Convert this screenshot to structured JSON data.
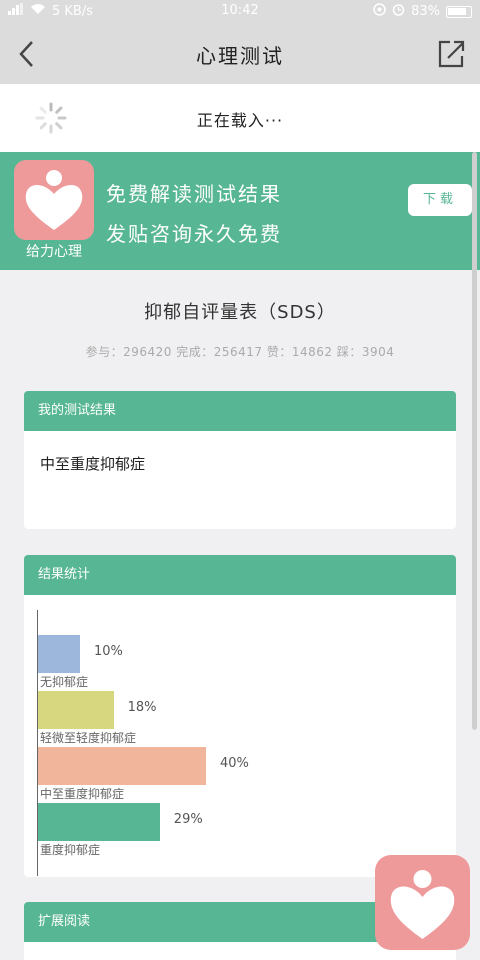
{
  "status_bar": {
    "network_speed": "5 KB/s",
    "time": "10:42",
    "battery": "83%"
  },
  "nav": {
    "title": "心理测试",
    "back_icon": "back-chevron-icon",
    "share_icon": "share-icon"
  },
  "loading": {
    "text": "正在载入···",
    "icon": "spinner-icon"
  },
  "banner": {
    "logo_text": "给力心理",
    "line1": "免费解读测试结果",
    "line2": "发贴咨询永久免费",
    "download_label": "下载",
    "logo_icon": "heart-icon",
    "accent_color": "#57b693",
    "logo_color": "#ef9a9a"
  },
  "test": {
    "title": "抑郁自评量表（SDS）",
    "stats": "参与：296420 完成：256417 赞：14862 踩：3904"
  },
  "result_card": {
    "header": "我的测试结果",
    "result": "中至重度抑郁症"
  },
  "stats_card": {
    "header": "结果统计"
  },
  "extend_card": {
    "header": "扩展阅读"
  },
  "chart_data": {
    "type": "bar",
    "orientation": "horizontal",
    "categories": [
      "无抑郁症",
      "轻微至轻度抑郁症",
      "中至重度抑郁症",
      "重度抑郁症"
    ],
    "values": [
      10,
      18,
      40,
      29
    ],
    "value_labels": [
      "10%",
      "18%",
      "40%",
      "29%"
    ],
    "colors": [
      "#9db6dc",
      "#d6d77f",
      "#f0b59a",
      "#57b693"
    ],
    "xlim": [
      0,
      100
    ],
    "grid": false
  }
}
